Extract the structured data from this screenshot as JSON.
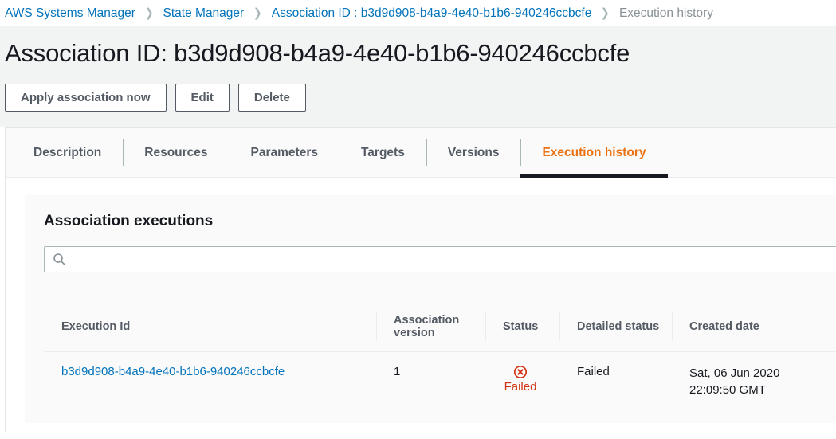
{
  "breadcrumb": {
    "items": [
      {
        "label": "AWS Systems Manager",
        "current": false
      },
      {
        "label": "State Manager",
        "current": false
      },
      {
        "label": "Association ID : b3d9d908-b4a9-4e40-b1b6-940246ccbcfe",
        "current": false
      },
      {
        "label": "Execution history",
        "current": true
      }
    ],
    "separator": "❯"
  },
  "header": {
    "title": "Association ID: b3d9d908-b4a9-4e40-b1b6-940246ccbcfe",
    "actions": [
      {
        "label": "Apply association now"
      },
      {
        "label": "Edit"
      },
      {
        "label": "Delete"
      }
    ]
  },
  "tabs": [
    {
      "label": "Description",
      "active": false
    },
    {
      "label": "Resources",
      "active": false
    },
    {
      "label": "Parameters",
      "active": false
    },
    {
      "label": "Targets",
      "active": false
    },
    {
      "label": "Versions",
      "active": false
    },
    {
      "label": "Execution history",
      "active": true
    }
  ],
  "card": {
    "title": "Association executions",
    "search": {
      "value": "",
      "placeholder": "",
      "icon": "search-icon"
    },
    "table": {
      "columns": [
        "Execution Id",
        "Association version",
        "Status",
        "Detailed status",
        "Created date"
      ],
      "rows": [
        {
          "execution_id": "b3d9d908-b4a9-4e40-b1b6-940246ccbcfe",
          "association_version": "1",
          "status": "Failed",
          "status_icon": "error-circle-icon",
          "detailed_status": "Failed",
          "created_date_line1": "Sat, 06 Jun 2020",
          "created_date_line2": "22:09:50 GMT"
        }
      ]
    }
  },
  "colors": {
    "link": "#0073bb",
    "accent": "#ec7211",
    "error": "#d13212",
    "text": "#16191f",
    "muted": "#545b64",
    "page_bg": "#f2f3f3",
    "card_bg": "#fafafa"
  }
}
